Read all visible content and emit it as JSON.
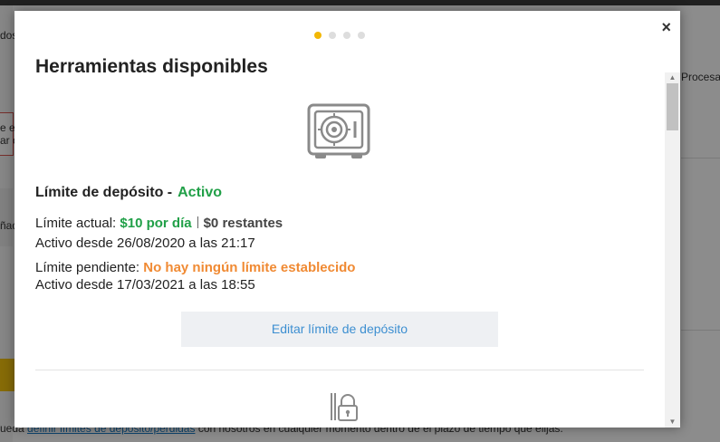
{
  "background": {
    "left_labels": [
      "dos",
      "e es",
      "ar c",
      "ñad"
    ],
    "right_label": "Procesad",
    "bottom_text_prefix": "ueda",
    "bottom_link": "definir límites de depósito/pérdidas",
    "bottom_text_suffix": " con nosotros en cualquier momento dentro de el plazo de tiempo que elijas."
  },
  "modal": {
    "close_label": "×",
    "carousel": {
      "total": 4,
      "active": 1
    },
    "title": "Herramientas disponibles",
    "deposit_limit": {
      "heading": "Límite de depósito -",
      "status": "Activo",
      "current_label": "Límite actual:",
      "current_value": "$10 por día",
      "remaining": "$0 restantes",
      "current_since": "Activo desde 26/08/2020 a las 21:17",
      "pending_label": "Límite pendiente:",
      "pending_value": "No hay ningún límite establecido",
      "pending_since": "Activo desde 17/03/2021 a las 18:55",
      "edit_button": "Editar límite de depósito"
    },
    "icons": {
      "safe": "safe-icon",
      "lock": "lock-icon"
    },
    "colors": {
      "active_green": "#21a048",
      "pending_orange": "#f08a33",
      "link_blue": "#3d8fd1",
      "dot_active": "#f2b705"
    }
  }
}
